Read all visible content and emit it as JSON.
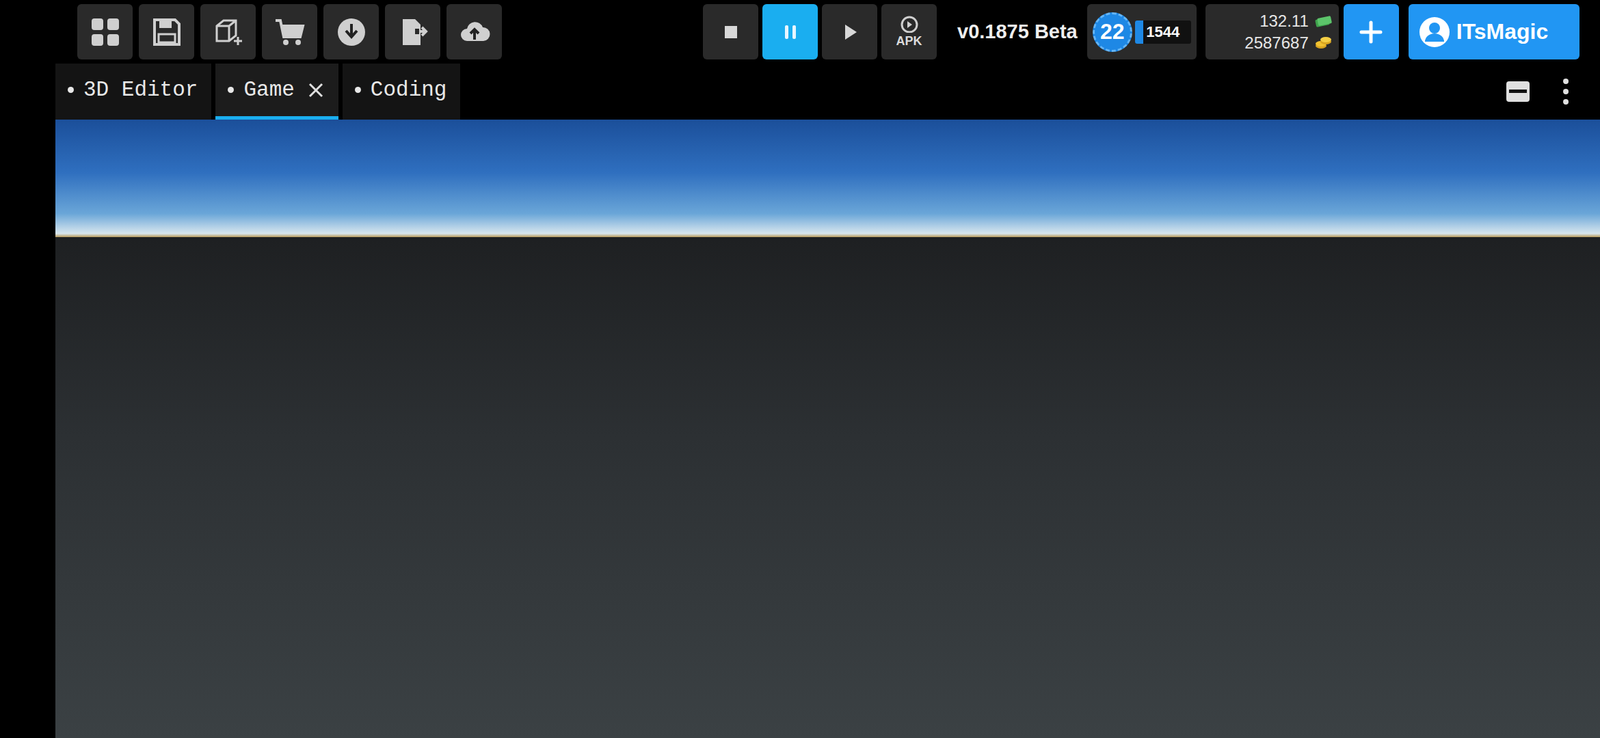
{
  "toolbar": {
    "playback": [
      {
        "kind": "stop",
        "selected": false
      },
      {
        "kind": "pause",
        "selected": true
      },
      {
        "kind": "play",
        "selected": false
      }
    ],
    "apk_label": "APK",
    "version": "v0.1875 Beta",
    "player_level": {
      "value": "22",
      "xp": "1544",
      "level": 0.15
    },
    "currency": [
      {
        "kind": "cash",
        "amount": "132.11"
      },
      {
        "kind": "coins",
        "amount": "2587687"
      }
    ],
    "account": {
      "name": "ITsMagic"
    }
  },
  "tabs": [
    {
      "label": "3D Editor",
      "selected": false,
      "closable": false
    },
    {
      "label": "Game",
      "selected": true,
      "closable": true
    },
    {
      "label": "Coding",
      "selected": false,
      "closable": false
    }
  ]
}
